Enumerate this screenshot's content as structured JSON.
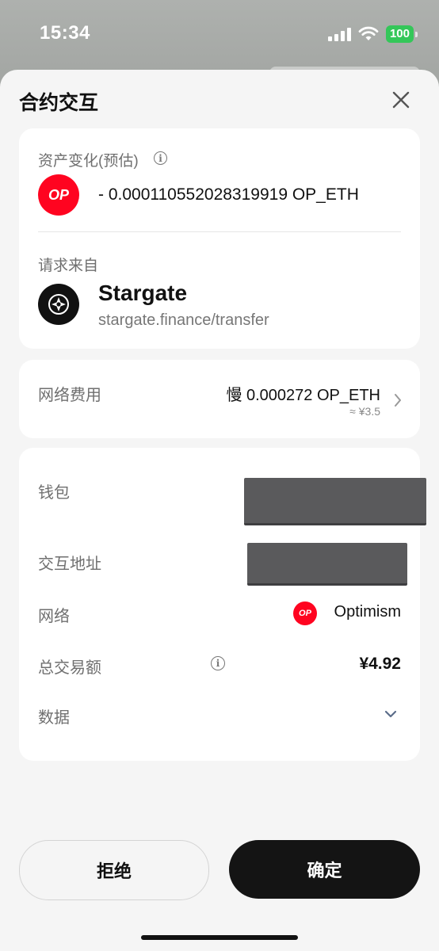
{
  "status_bar": {
    "time": "15:34",
    "battery": "100"
  },
  "sheet": {
    "title": "合约交互"
  },
  "asset_change": {
    "label": "资产变化(预估)",
    "token_badge": "OP",
    "amount": "- 0.000110552028319919 OP_ETH"
  },
  "request": {
    "label": "请求来自",
    "dapp_name": "Stargate",
    "dapp_url": "stargate.finance/transfer"
  },
  "network_fee": {
    "label": "网络费用",
    "value": "慢 0.000272 OP_ETH",
    "fiat": "≈ ¥3.5"
  },
  "details": {
    "wallet_label": "钱包",
    "contract_label": "交互地址",
    "network_label": "网络",
    "network_badge": "OP",
    "network_value": "Optimism",
    "total_label": "总交易额",
    "total_value": "¥4.92",
    "data_label": "数据"
  },
  "actions": {
    "reject": "拒绝",
    "confirm": "确定"
  },
  "colors": {
    "op_red": "#ff0420",
    "confirm_bg": "#141414",
    "battery_green": "#34c759"
  },
  "icons": [
    "signal-icon",
    "wifi-icon",
    "battery-icon",
    "close-icon",
    "info-icon",
    "stargate-logo-icon",
    "chevron-right-icon",
    "chevron-down-icon"
  ]
}
